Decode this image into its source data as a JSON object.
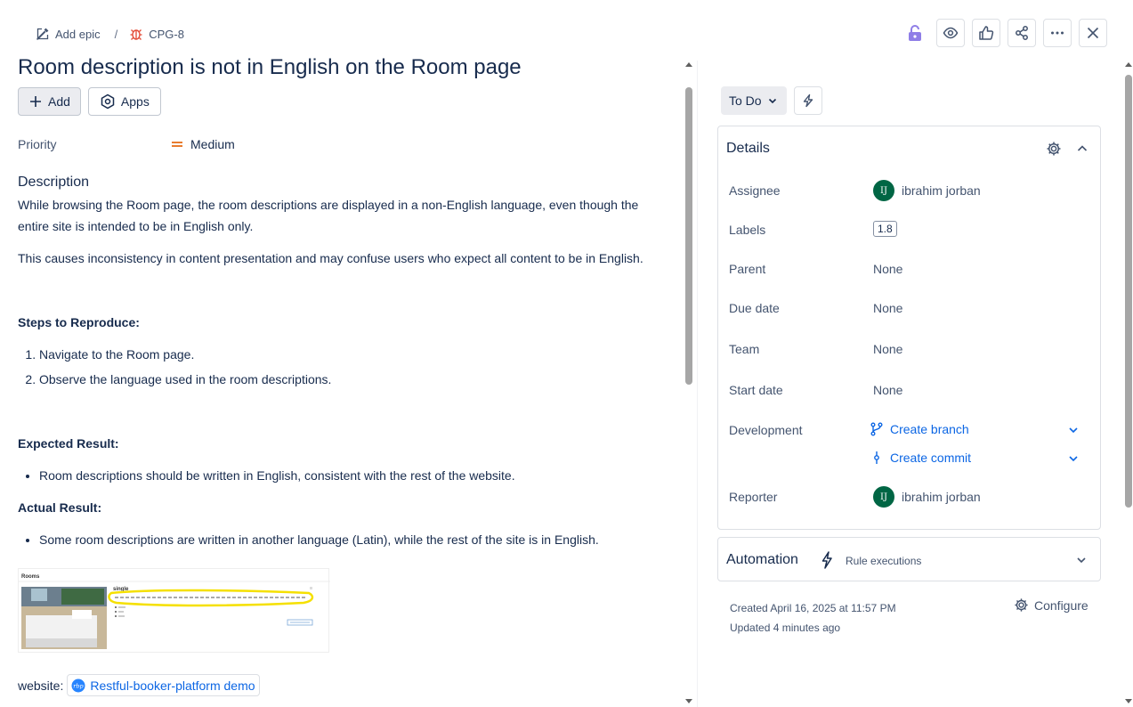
{
  "breadcrumb": {
    "add_epic": "Add epic",
    "separator": "/",
    "issue_key": "CPG-8"
  },
  "issue": {
    "title": "Room description is not in English on the Room page"
  },
  "actions": {
    "add": "Add",
    "apps": "Apps"
  },
  "priority": {
    "label": "Priority",
    "value": "Medium"
  },
  "description": {
    "heading": "Description",
    "p1": "While browsing the Room page, the room descriptions are displayed in a non-English language, even though the entire site is intended to be in English only.",
    "p2": "This causes inconsistency in content presentation and may confuse users who expect all content to be in English.",
    "steps_heading": "Steps to Reproduce:",
    "steps": [
      "Navigate to the Room page.",
      "Observe the language used in the room descriptions."
    ],
    "expected_heading": "Expected Result:",
    "expected": "Room descriptions should be written in English, consistent with the rest of the website.",
    "actual_heading": "Actual Result:",
    "actual": "Some room descriptions are written in another language (Latin), while the rest of the site is in English.",
    "website_label": "website:",
    "website_link": "Restful-booker-platform demo"
  },
  "attachment": {
    "rooms_title": "Rooms",
    "room_name": "single"
  },
  "status": {
    "value": "To Do"
  },
  "details": {
    "heading": "Details",
    "assignee": {
      "label": "Assignee",
      "initials": "IJ",
      "name": "ibrahim jorban"
    },
    "labels": {
      "label": "Labels",
      "tag": "1.8"
    },
    "parent": {
      "label": "Parent",
      "value": "None"
    },
    "due_date": {
      "label": "Due date",
      "value": "None"
    },
    "team": {
      "label": "Team",
      "value": "None"
    },
    "start_date": {
      "label": "Start date",
      "value": "None"
    },
    "development": {
      "label": "Development",
      "branch": "Create branch",
      "commit": "Create commit"
    },
    "reporter": {
      "label": "Reporter",
      "initials": "IJ",
      "name": "ibrahim jorban"
    }
  },
  "automation": {
    "heading": "Automation",
    "sub": "Rule executions"
  },
  "meta": {
    "created": "Created April 16, 2025 at 11:57 PM",
    "updated": "Updated 4 minutes ago",
    "configure": "Configure"
  },
  "colors": {
    "accent": "#0c66e4",
    "priority": "#e56910",
    "bug": "#e34935",
    "lock": "#8f7ee7",
    "avatar": "#006644"
  }
}
